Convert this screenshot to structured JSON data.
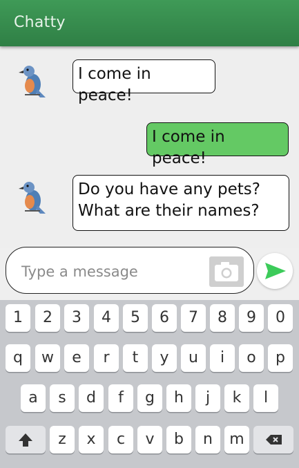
{
  "app": {
    "title": "Chatty"
  },
  "messages": [
    {
      "from": "bot",
      "lines": [
        "I come in peace!"
      ]
    },
    {
      "from": "user",
      "lines": [
        "I come in peace!"
      ]
    },
    {
      "from": "bot",
      "lines": [
        "Do you have any pets?",
        "What are their names?"
      ]
    }
  ],
  "composer": {
    "placeholder": "Type a message",
    "value": ""
  },
  "keyboard": {
    "row1": [
      "1",
      "2",
      "3",
      "4",
      "5",
      "6",
      "7",
      "8",
      "9",
      "0"
    ],
    "row2": [
      "q",
      "w",
      "e",
      "r",
      "t",
      "y",
      "u",
      "i",
      "o",
      "p"
    ],
    "row3": [
      "a",
      "s",
      "d",
      "f",
      "g",
      "h",
      "j",
      "k",
      "l"
    ],
    "row4": [
      "z",
      "x",
      "c",
      "v",
      "b",
      "n",
      "m"
    ],
    "shift_icon": "shift-arrow-icon",
    "backspace_icon": "backspace-icon"
  },
  "icons": {
    "avatar": "bird-avatar-icon",
    "camera": "camera-icon",
    "send": "send-arrow-icon"
  },
  "colors": {
    "appbar": "#3b9152",
    "outgoing_bubble": "#64c964",
    "send_arrow": "#3ccb5a"
  }
}
